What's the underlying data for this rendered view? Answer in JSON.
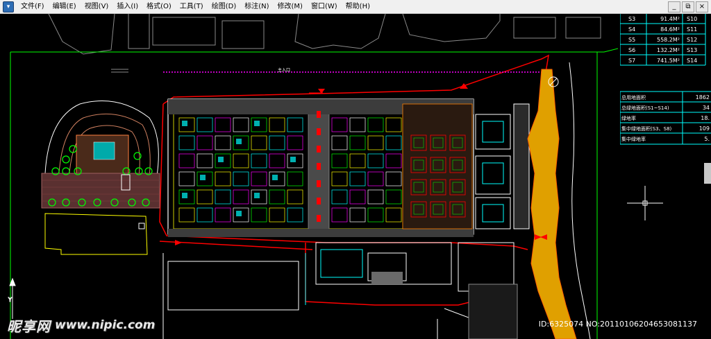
{
  "menubar": {
    "app_icon": "cad-app-icon",
    "items": [
      "文件(F)",
      "编辑(E)",
      "视图(V)",
      "插入(I)",
      "格式(O)",
      "工具(T)",
      "绘图(D)",
      "标注(N)",
      "修改(M)",
      "窗口(W)",
      "帮助(H)"
    ],
    "window_controls": [
      "_",
      "⧉",
      "×"
    ]
  },
  "table": {
    "rows": [
      {
        "a": "S3",
        "b": "91.4M²",
        "c": "S10"
      },
      {
        "a": "S4",
        "b": "84.6M²",
        "c": "S11"
      },
      {
        "a": "S5",
        "b": "558.2M²",
        "c": "S12"
      },
      {
        "a": "S6",
        "b": "132.2M²",
        "c": "S13"
      },
      {
        "a": "S7",
        "b": "741.5M²",
        "c": "S14"
      }
    ],
    "summary": [
      {
        "label": "总用地面积",
        "value": "1862"
      },
      {
        "label": "总绿地面积(S1~S14)",
        "value": "34"
      },
      {
        "label": "绿地率",
        "value": "18."
      },
      {
        "label": "集中绿地面积(S3、S8)",
        "value": "109"
      },
      {
        "label": "集中绿地率",
        "value": "5."
      }
    ]
  },
  "drawing": {
    "entrance_label": "主入口"
  },
  "watermark": {
    "brand": "昵享网",
    "url": "www.nipic.com",
    "id_text": "ID:6325074 NO:20110106204653081137"
  },
  "colors": {
    "background": "#000000",
    "red": "#ff0000",
    "yellow": "#ffff00",
    "cyan": "#00ffff",
    "green": "#00ff00",
    "magenta": "#ff00ff",
    "white": "#ffffff",
    "gray": "#8a8a8a",
    "orange": "#ffaa00"
  }
}
